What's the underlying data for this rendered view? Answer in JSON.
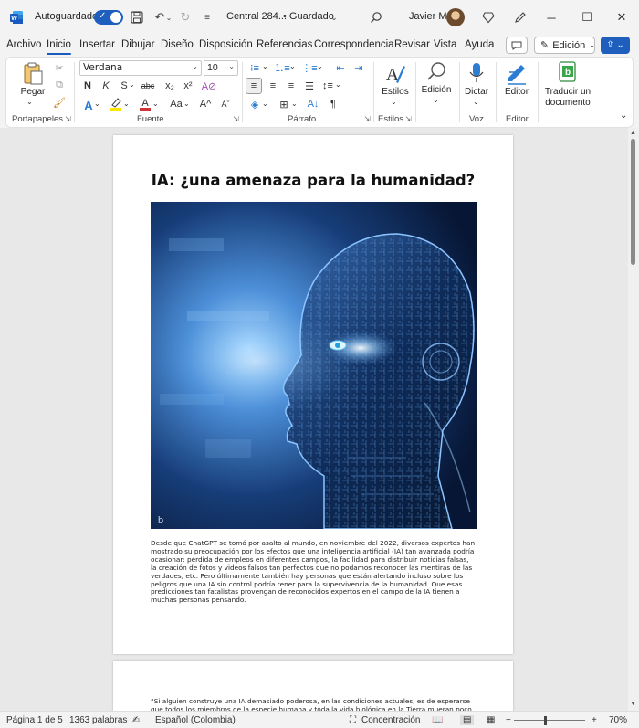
{
  "titlebar": {
    "autosave_label": "Autoguardado",
    "doc_title": "Central 284...",
    "saved_status": "• Guardado",
    "user_name": "Javier M"
  },
  "menu": {
    "tabs": [
      "Archivo",
      "Inicio",
      "Insertar",
      "Dibujar",
      "Diseño",
      "Disposición",
      "Referencias",
      "Correspondencia",
      "Revisar",
      "Vista",
      "Ayuda"
    ],
    "active_tab": "Inicio",
    "edit_mode_label": "Edición"
  },
  "ribbon": {
    "paste_label": "Pegar",
    "font_name": "Verdana",
    "font_size": "10",
    "styles_label": "Estilos",
    "editing_label": "Edición",
    "dictate_label": "Dictar",
    "editor_label": "Editor",
    "translate_label_1": "Traducir un",
    "translate_label_2": "documento",
    "group_labels": {
      "clipboard": "Portapapeles",
      "font": "Fuente",
      "paragraph": "Párrafo",
      "styles": "Estilos",
      "voice": "Voz",
      "editor": "Editor"
    },
    "format_glyphs": {
      "bold": "N",
      "italic": "K",
      "underline": "S",
      "strikethrough": "abc",
      "subscript": "x₂",
      "superscript": "x²",
      "grow_font": "A^",
      "shrink_font": "Aˇ",
      "pilcrow": "¶"
    }
  },
  "document": {
    "heading": "IA: ¿una amenaza para la humanidad?",
    "image_watermark": "b",
    "paragraph_1": "Desde que ChatGPT se tomó por asalto al mundo, en noviembre del 2022, diversos expertos han mostrado su preocupación por los efectos que una inteligencia artificial (IA) tan avanzada podría ocasionar: pérdida de empleos en diferentes campos, la facilidad para distribuir noticias falsas, la creación de fotos y videos falsos tan perfectos que no podamos reconocer las mentiras de las verdades, etc. Pero últimamente también hay personas que están alertando incluso sobre los peligros que una IA sin control podría tener para la supervivencia de la humanidad. Que esas predicciones tan fatalistas provengan de reconocidos expertos en el campo de la IA tienen a muchas personas pensando.",
    "paragraph_2": "“Si alguien construye una IA demasiado poderosa, en las condiciones actuales, es de esperarse que todos los miembros de la especie humana y toda la vida biológica en la Tierra mueran poco"
  },
  "statusbar": {
    "page": "Página 1 de 5",
    "words": "1363 palabras",
    "language": "Español (Colombia)",
    "focus": "Concentración",
    "zoom_minus": "−",
    "zoom_plus": "+",
    "zoom": "70%",
    "zoom_level_percent": 70
  },
  "colors": {
    "accent": "#1e5fbe",
    "highlight": "#ffe600",
    "font_color": "#d13438"
  },
  "icons": [
    "word-logo-icon",
    "save-icon",
    "undo-icon",
    "redo-icon",
    "customize-icon",
    "search-icon",
    "diamond-icon",
    "pen-icon",
    "minimize-icon",
    "maximize-icon",
    "close-icon",
    "comment-icon",
    "share-icon",
    "microphone-icon",
    "translate-icon"
  ]
}
